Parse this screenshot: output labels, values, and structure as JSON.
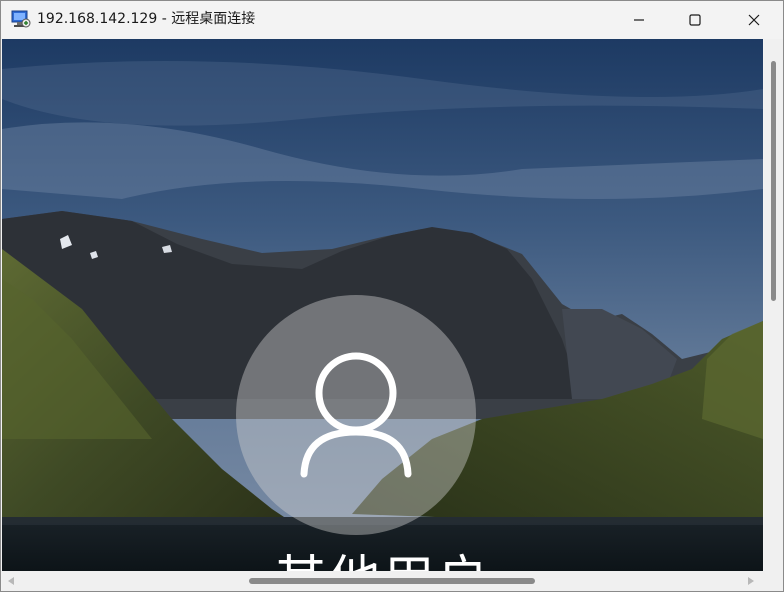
{
  "window": {
    "title": "192.168.142.129 - 远程桌面连接",
    "app_icon": "remote-desktop-icon",
    "controls": {
      "minimize": "minimize-icon",
      "maximize": "maximize-icon",
      "close": "close-icon"
    }
  },
  "lock_screen": {
    "avatar_icon": "user-icon",
    "username": "其他用户"
  },
  "scrollbars": {
    "vertical": "vertical-scrollbar",
    "horizontal": "horizontal-scrollbar"
  },
  "colors": {
    "titlebar": "#f3f3f3",
    "sky_top": "#1f3f6a",
    "avatar_fill": "#c8c8c8"
  }
}
